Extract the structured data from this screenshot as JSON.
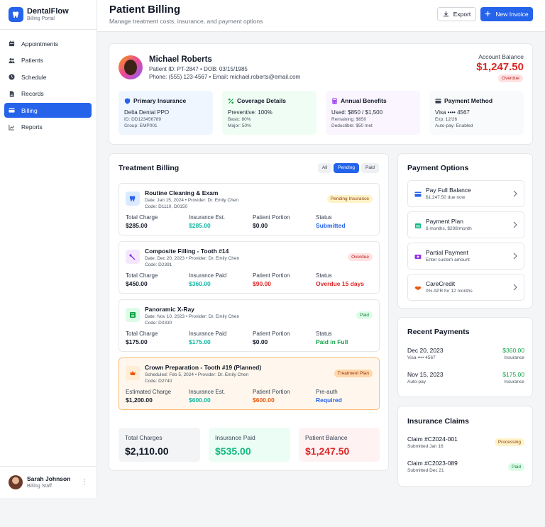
{
  "brand": {
    "name": "DentalFlow",
    "subtitle": "Billing Portal",
    "logo_icon": "tooth-icon",
    "accent": "#2563eb"
  },
  "nav": [
    {
      "label": "Appointments",
      "icon": "calendar-icon",
      "active": false
    },
    {
      "label": "Patients",
      "icon": "users-icon",
      "active": false
    },
    {
      "label": "Schedule",
      "icon": "clock-icon",
      "active": false
    },
    {
      "label": "Records",
      "icon": "file-icon",
      "active": false
    },
    {
      "label": "Billing",
      "icon": "credit-card-icon",
      "active": true
    },
    {
      "label": "Reports",
      "icon": "chart-line-icon",
      "active": false
    }
  ],
  "user": {
    "name": "Sarah Johnson",
    "role": "Billing Staff",
    "menu_glyph": "⋮"
  },
  "header": {
    "title": "Patient Billing",
    "subtitle": "Manage treatment costs, insurance, and payment options",
    "export_label": "Export",
    "new_label": "New Invoice"
  },
  "patient": {
    "name": "Michael Roberts",
    "id_line": "Patient ID: PT-2847 • DOB: 03/15/1985",
    "contact_line": "Phone: (555) 123-4567 • Email: michael.roberts@email.com",
    "balance_label": "Account Balance",
    "balance": "$1,247.50",
    "balance_status": "Overdue"
  },
  "info_boxes": [
    {
      "title": "Primary Insurance",
      "main": "Delta Dental PPO",
      "lines": [
        "ID: DD123456789",
        "Group: EMP001"
      ],
      "bg": "#eff6ff",
      "icon": "shield-icon"
    },
    {
      "title": "Coverage Details",
      "main": "Preventive: 100%",
      "lines": [
        "Basic: 80%",
        "Major: 50%"
      ],
      "bg": "#f0fdf4",
      "icon": "percent-icon"
    },
    {
      "title": "Annual Benefits",
      "main": "Used: $850 / $1,500",
      "lines": [
        "Remaining: $650",
        "Deductible: $50 met"
      ],
      "bg": "#faf5ff",
      "icon": "calculator-icon"
    },
    {
      "title": "Payment Method",
      "main": "Visa •••• 4567",
      "lines": [
        "Exp: 12/26",
        "Auto-pay: Enabled"
      ],
      "bg": "#f9fafb",
      "icon": "card-icon"
    }
  ],
  "billing": {
    "title": "Treatment Billing",
    "filters": [
      {
        "label": "All",
        "active": false
      },
      {
        "label": "Pending",
        "active": true
      },
      {
        "label": "Paid",
        "active": false
      }
    ],
    "treatments": [
      {
        "name": "Routine Cleaning & Exam",
        "meta": "Date: Jan 15, 2024 • Provider: Dr. Emily Chen",
        "code": "Code: D1110, D0150",
        "badge": "Pending Insurance",
        "icon": "tooth-icon",
        "cols": [
          {
            "label": "Total Charge",
            "value": "$285.00"
          },
          {
            "label": "Insurance Est.",
            "value": "$285.00"
          },
          {
            "label": "Patient Portion",
            "value": "$0.00"
          },
          {
            "label": "Status",
            "value": "Submitted"
          }
        ]
      },
      {
        "name": "Composite Filling - Tooth #14",
        "meta": "Date: Dec 20, 2023 • Provider: Dr. Emily Chen",
        "code": "Code: D2391",
        "badge": "Overdue",
        "icon": "drill-icon",
        "cols": [
          {
            "label": "Total Charge",
            "value": "$450.00"
          },
          {
            "label": "Insurance Paid",
            "value": "$360.00"
          },
          {
            "label": "Patient Portion",
            "value": "$90.00"
          },
          {
            "label": "Status",
            "value": "Overdue 15 days"
          }
        ]
      },
      {
        "name": "Panoramic X-Ray",
        "meta": "Date: Nov 10, 2023 • Provider: Dr. Emily Chen",
        "code": "Code: D0330",
        "badge": "Paid",
        "icon": "xray-icon",
        "cols": [
          {
            "label": "Total Charge",
            "value": "$175.00"
          },
          {
            "label": "Insurance Paid",
            "value": "$175.00"
          },
          {
            "label": "Patient Portion",
            "value": "$0.00"
          },
          {
            "label": "Status",
            "value": "Paid in Full"
          }
        ]
      },
      {
        "name": "Crown Preparation - Tooth #19 (Planned)",
        "meta": "Scheduled: Feb 5, 2024 • Provider: Dr. Emily Chen",
        "code": "Code: D2740",
        "badge": "Treatment Plan",
        "icon": "crown-icon",
        "cols": [
          {
            "label": "Estimated Charge",
            "value": "$1,200.00"
          },
          {
            "label": "Insurance Est.",
            "value": "$600.00"
          },
          {
            "label": "Patient Portion",
            "value": "$600.00"
          },
          {
            "label": "Pre-auth",
            "value": "Required"
          }
        ]
      }
    ],
    "summary": [
      {
        "label": "Total Charges",
        "value": "$2,110.00"
      },
      {
        "label": "Insurance Paid",
        "value": "$535.00"
      },
      {
        "label": "Patient Balance",
        "value": "$1,247.50"
      }
    ]
  },
  "payment_options": {
    "title": "Payment Options",
    "items": [
      {
        "title": "Pay Full Balance",
        "sub": "$1,247.50 due now",
        "icon": "card-icon"
      },
      {
        "title": "Payment Plan",
        "sub": "6 months, $208/month",
        "icon": "calendar-icon"
      },
      {
        "title": "Partial Payment",
        "sub": "Enter custom amount",
        "icon": "money-icon"
      },
      {
        "title": "CareCredit",
        "sub": "0% APR for 12 months",
        "icon": "handshake-icon"
      }
    ]
  },
  "recent_payments": {
    "title": "Recent Payments",
    "items": [
      {
        "date": "Dec 20, 2023",
        "method": "Visa •••• 4567",
        "amount": "$360.00",
        "source": "Insurance"
      },
      {
        "date": "Nov 15, 2023",
        "method": "Auto-pay",
        "amount": "$175.00",
        "source": "Insurance"
      }
    ]
  },
  "claims": {
    "title": "Insurance Claims",
    "items": [
      {
        "id": "Claim #C2024-001",
        "sub": "Submitted Jan 16",
        "status": "Processing"
      },
      {
        "id": "Claim #C2023-089",
        "sub": "Submitted Dec 21",
        "status": "Paid"
      }
    ]
  }
}
